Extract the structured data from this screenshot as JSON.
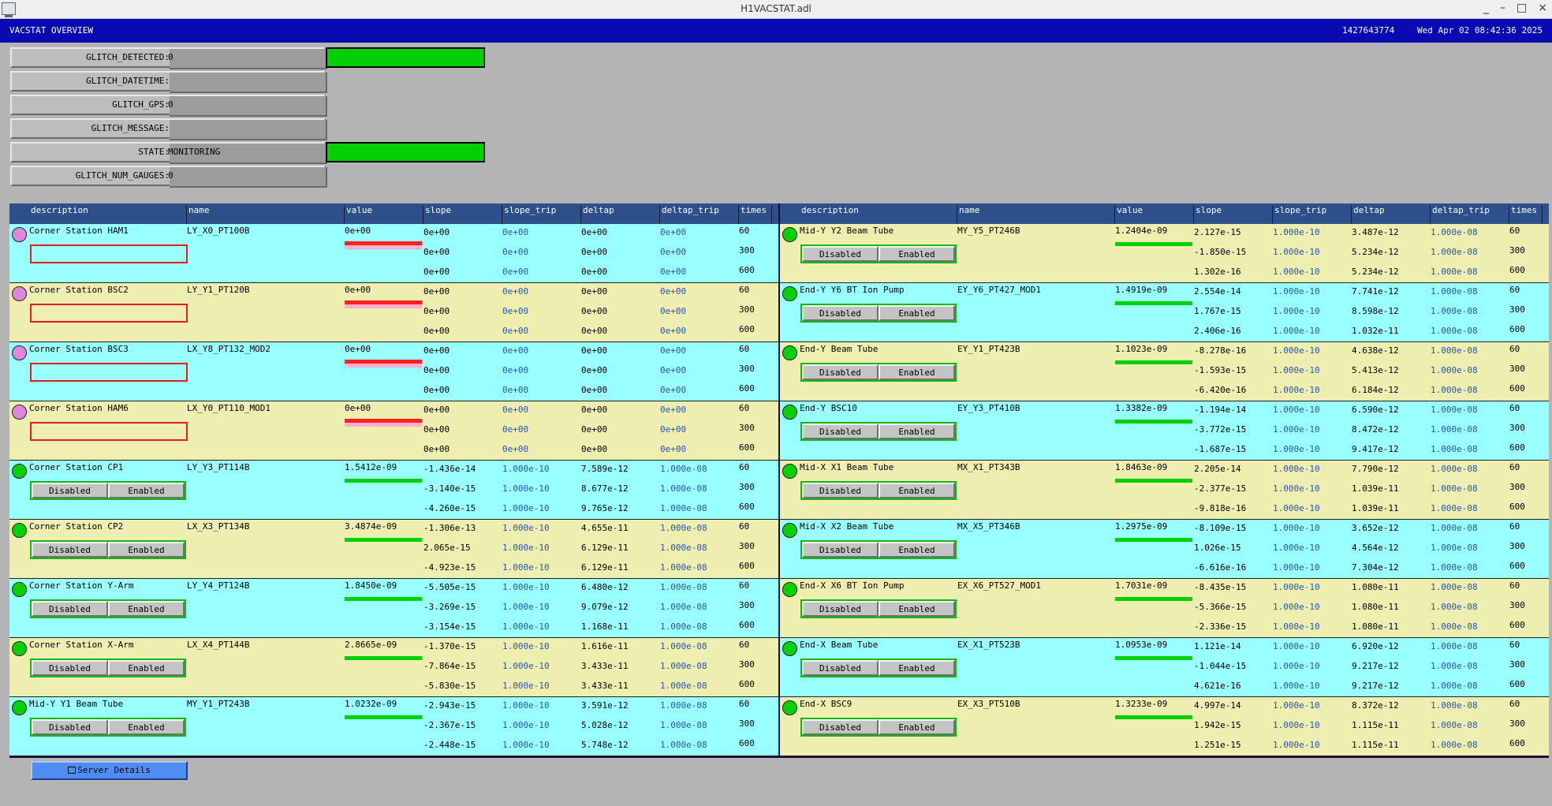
{
  "window": {
    "title": "H1VACSTAT.adl",
    "buttons": [
      "_",
      "–",
      "□",
      "×"
    ]
  },
  "header": {
    "title": "VACSTAT OVERVIEW",
    "gps": "1427643774",
    "datetime": "Wed Apr 02 08:42:36 2025"
  },
  "glitch": [
    {
      "label": "GLITCH_DETECTED:",
      "value": "0",
      "status": true
    },
    {
      "label": "GLITCH_DATETIME:",
      "value": "",
      "status": false
    },
    {
      "label": "GLITCH_GPS:",
      "value": "0",
      "status": false
    },
    {
      "label": "GLITCH_MESSAGE:",
      "value": "",
      "status": false
    },
    {
      "label": "STATE:",
      "value": "MONITORING",
      "status": true
    },
    {
      "label": "GLITCH_NUM_GAUGES:",
      "value": "0",
      "status": false
    }
  ],
  "colors": {
    "ok": "#05cf05",
    "alarm": "#e02020",
    "invalid": "#dd88dd",
    "cyan_row": "#99ffff",
    "khaki_row": "#eeeeb0",
    "header_bg": "#2d4f8a",
    "topbar": "#0a0ab2"
  },
  "columns": [
    "description",
    "name",
    "value",
    "slope",
    "slope_trip",
    "deltap",
    "deltap_trip",
    "times"
  ],
  "times": [
    "60",
    "300",
    "600"
  ],
  "toggle_labels": {
    "disabled": "Disabled",
    "enabled": "Enabled"
  },
  "left_rows": [
    {
      "desc": "Corner Station HAM1",
      "name": "LY_X0_PT100B",
      "value": "0e+00",
      "status": "invalid",
      "bar": "red",
      "slope": [
        "0e+00",
        "0e+00",
        "0e+00"
      ],
      "slope_trip": [
        "0e+00",
        "0e+00",
        "0e+00"
      ],
      "deltap": [
        "0e+00",
        "0e+00",
        "0e+00"
      ],
      "deltap_trip": [
        "0e+00",
        "0e+00",
        "0e+00"
      ]
    },
    {
      "desc": "Corner Station BSC2",
      "name": "LY_Y1_PT120B",
      "value": "0e+00",
      "status": "invalid",
      "bar": "red",
      "slope": [
        "0e+00",
        "0e+00",
        "0e+00"
      ],
      "slope_trip": [
        "0e+00",
        "0e+00",
        "0e+00"
      ],
      "deltap": [
        "0e+00",
        "0e+00",
        "0e+00"
      ],
      "deltap_trip": [
        "0e+00",
        "0e+00",
        "0e+00"
      ]
    },
    {
      "desc": "Corner Station BSC3",
      "name": "LX_Y8_PT132_MOD2",
      "value": "0e+00",
      "status": "invalid",
      "bar": "red",
      "slope": [
        "0e+00",
        "0e+00",
        "0e+00"
      ],
      "slope_trip": [
        "0e+00",
        "0e+00",
        "0e+00"
      ],
      "deltap": [
        "0e+00",
        "0e+00",
        "0e+00"
      ],
      "deltap_trip": [
        "0e+00",
        "0e+00",
        "0e+00"
      ]
    },
    {
      "desc": "Corner Station HAM6",
      "name": "LX_Y0_PT110_MOD1",
      "value": "0e+00",
      "status": "invalid",
      "bar": "red",
      "slope": [
        "0e+00",
        "0e+00",
        "0e+00"
      ],
      "slope_trip": [
        "0e+00",
        "0e+00",
        "0e+00"
      ],
      "deltap": [
        "0e+00",
        "0e+00",
        "0e+00"
      ],
      "deltap_trip": [
        "0e+00",
        "0e+00",
        "0e+00"
      ]
    },
    {
      "desc": "Corner Station CP1",
      "name": "LY_Y3_PT114B",
      "value": "1.5412e-09",
      "status": "ok",
      "bar": "green",
      "slope": [
        "-1.436e-14",
        "-3.140e-15",
        "-4.260e-15"
      ],
      "slope_trip": [
        "1.000e-10",
        "1.000e-10",
        "1.000e-10"
      ],
      "deltap": [
        "7.589e-12",
        "8.677e-12",
        "9.765e-12"
      ],
      "deltap_trip": [
        "1.000e-08",
        "1.000e-08",
        "1.000e-08"
      ]
    },
    {
      "desc": "Corner Station CP2",
      "name": "LX_X3_PT134B",
      "value": "3.4874e-09",
      "status": "ok",
      "bar": "green",
      "slope": [
        "-1.306e-13",
        "2.065e-15",
        "-4.923e-15"
      ],
      "slope_trip": [
        "1.000e-10",
        "1.000e-10",
        "1.000e-10"
      ],
      "deltap": [
        "4.655e-11",
        "6.129e-11",
        "6.129e-11"
      ],
      "deltap_trip": [
        "1.000e-08",
        "1.000e-08",
        "1.000e-08"
      ]
    },
    {
      "desc": "Corner Station Y-Arm",
      "name": "LY_Y4_PT124B",
      "value": "1.8450e-09",
      "status": "ok",
      "bar": "green",
      "slope": [
        "-5.505e-15",
        "-3.269e-15",
        "-3.154e-15"
      ],
      "slope_trip": [
        "1.000e-10",
        "1.000e-10",
        "1.000e-10"
      ],
      "deltap": [
        "6.480e-12",
        "9.079e-12",
        "1.168e-11"
      ],
      "deltap_trip": [
        "1.000e-08",
        "1.000e-08",
        "1.000e-08"
      ]
    },
    {
      "desc": "Corner Station X-Arm",
      "name": "LX_X4_PT144B",
      "value": "2.8665e-09",
      "status": "ok",
      "bar": "green",
      "slope": [
        "-1.370e-15",
        "-7.864e-15",
        "-5.830e-15"
      ],
      "slope_trip": [
        "1.000e-10",
        "1.000e-10",
        "1.000e-10"
      ],
      "deltap": [
        "1.616e-11",
        "3.433e-11",
        "3.433e-11"
      ],
      "deltap_trip": [
        "1.000e-08",
        "1.000e-08",
        "1.000e-08"
      ]
    },
    {
      "desc": "Mid-Y Y1 Beam Tube",
      "name": "MY_Y1_PT243B",
      "value": "1.0232e-09",
      "status": "ok",
      "bar": "green",
      "slope": [
        "-2.943e-15",
        "-2.367e-15",
        "-2.448e-15"
      ],
      "slope_trip": [
        "1.000e-10",
        "1.000e-10",
        "1.000e-10"
      ],
      "deltap": [
        "3.591e-12",
        "5.028e-12",
        "5.748e-12"
      ],
      "deltap_trip": [
        "1.000e-08",
        "1.000e-08",
        "1.000e-08"
      ]
    }
  ],
  "right_rows": [
    {
      "desc": "Mid-Y Y2 Beam Tube",
      "name": "MY_Y5_PT246B",
      "value": "1.2404e-09",
      "status": "ok",
      "bar": "green",
      "slope": [
        "2.127e-15",
        "-1.850e-15",
        "1.302e-16"
      ],
      "slope_trip": [
        "1.000e-10",
        "1.000e-10",
        "1.000e-10"
      ],
      "deltap": [
        "3.487e-12",
        "5.234e-12",
        "5.234e-12"
      ],
      "deltap_trip": [
        "1.000e-08",
        "1.000e-08",
        "1.000e-08"
      ]
    },
    {
      "desc": "End-Y Y6 BT Ion Pump",
      "name": "EY_Y6_PT427_MOD1",
      "value": "1.4919e-09",
      "status": "ok",
      "bar": "green",
      "slope": [
        "2.554e-14",
        "1.767e-15",
        "2.406e-16"
      ],
      "slope_trip": [
        "1.000e-10",
        "1.000e-10",
        "1.000e-10"
      ],
      "deltap": [
        "7.741e-12",
        "8.598e-12",
        "1.032e-11"
      ],
      "deltap_trip": [
        "1.000e-08",
        "1.000e-08",
        "1.000e-08"
      ]
    },
    {
      "desc": "End-Y Beam Tube",
      "name": "EY_Y1_PT423B",
      "value": "1.1023e-09",
      "status": "ok",
      "bar": "green",
      "slope": [
        "-8.278e-16",
        "-1.593e-15",
        "-6.420e-16"
      ],
      "slope_trip": [
        "1.000e-10",
        "1.000e-10",
        "1.000e-10"
      ],
      "deltap": [
        "4.638e-12",
        "5.413e-12",
        "6.184e-12"
      ],
      "deltap_trip": [
        "1.000e-08",
        "1.000e-08",
        "1.000e-08"
      ]
    },
    {
      "desc": "End-Y BSC10",
      "name": "EY_Y3_PT410B",
      "value": "1.3382e-09",
      "status": "ok",
      "bar": "green",
      "slope": [
        "-1.194e-14",
        "-3.772e-15",
        "-1.687e-15"
      ],
      "slope_trip": [
        "1.000e-10",
        "1.000e-10",
        "1.000e-10"
      ],
      "deltap": [
        "6.590e-12",
        "8.472e-12",
        "9.417e-12"
      ],
      "deltap_trip": [
        "1.000e-08",
        "1.000e-08",
        "1.000e-08"
      ]
    },
    {
      "desc": "Mid-X X1 Beam Tube",
      "name": "MX_X1_PT343B",
      "value": "1.8463e-09",
      "status": "ok",
      "bar": "green",
      "slope": [
        "2.205e-14",
        "-2.377e-15",
        "-9.818e-16"
      ],
      "slope_trip": [
        "1.000e-10",
        "1.000e-10",
        "1.000e-10"
      ],
      "deltap": [
        "7.790e-12",
        "1.039e-11",
        "1.039e-11"
      ],
      "deltap_trip": [
        "1.000e-08",
        "1.000e-08",
        "1.000e-08"
      ]
    },
    {
      "desc": "Mid-X X2 Beam Tube",
      "name": "MX_X5_PT346B",
      "value": "1.2975e-09",
      "status": "ok",
      "bar": "green",
      "slope": [
        "-8.109e-15",
        "1.026e-15",
        "-6.616e-16"
      ],
      "slope_trip": [
        "1.000e-10",
        "1.000e-10",
        "1.000e-10"
      ],
      "deltap": [
        "3.652e-12",
        "4.564e-12",
        "7.304e-12"
      ],
      "deltap_trip": [
        "1.000e-08",
        "1.000e-08",
        "1.000e-08"
      ]
    },
    {
      "desc": "End-X X6 BT Ion Pump",
      "name": "EX_X6_PT527_MOD1",
      "value": "1.7031e-09",
      "status": "ok",
      "bar": "green",
      "slope": [
        "-8.435e-15",
        "-5.366e-15",
        "-2.336e-15"
      ],
      "slope_trip": [
        "1.000e-10",
        "1.000e-10",
        "1.000e-10"
      ],
      "deltap": [
        "1.080e-11",
        "1.080e-11",
        "1.080e-11"
      ],
      "deltap_trip": [
        "1.000e-08",
        "1.000e-08",
        "1.000e-08"
      ]
    },
    {
      "desc": "End-X Beam Tube",
      "name": "EX_X1_PT523B",
      "value": "1.0953e-09",
      "status": "ok",
      "bar": "green",
      "slope": [
        "1.121e-14",
        "-1.044e-15",
        "4.621e-16"
      ],
      "slope_trip": [
        "1.000e-10",
        "1.000e-10",
        "1.000e-10"
      ],
      "deltap": [
        "6.920e-12",
        "9.217e-12",
        "9.217e-12"
      ],
      "deltap_trip": [
        "1.000e-08",
        "1.000e-08",
        "1.000e-08"
      ]
    },
    {
      "desc": "End-X BSC9",
      "name": "EX_X3_PT510B",
      "value": "1.3233e-09",
      "status": "ok",
      "bar": "green",
      "slope": [
        "4.997e-14",
        "1.942e-15",
        "1.251e-15"
      ],
      "slope_trip": [
        "1.000e-10",
        "1.000e-10",
        "1.000e-10"
      ],
      "deltap": [
        "8.372e-12",
        "1.115e-11",
        "1.115e-11"
      ],
      "deltap_trip": [
        "1.000e-08",
        "1.000e-08",
        "1.000e-08"
      ]
    }
  ],
  "footer": {
    "server_button": "Server Details"
  }
}
